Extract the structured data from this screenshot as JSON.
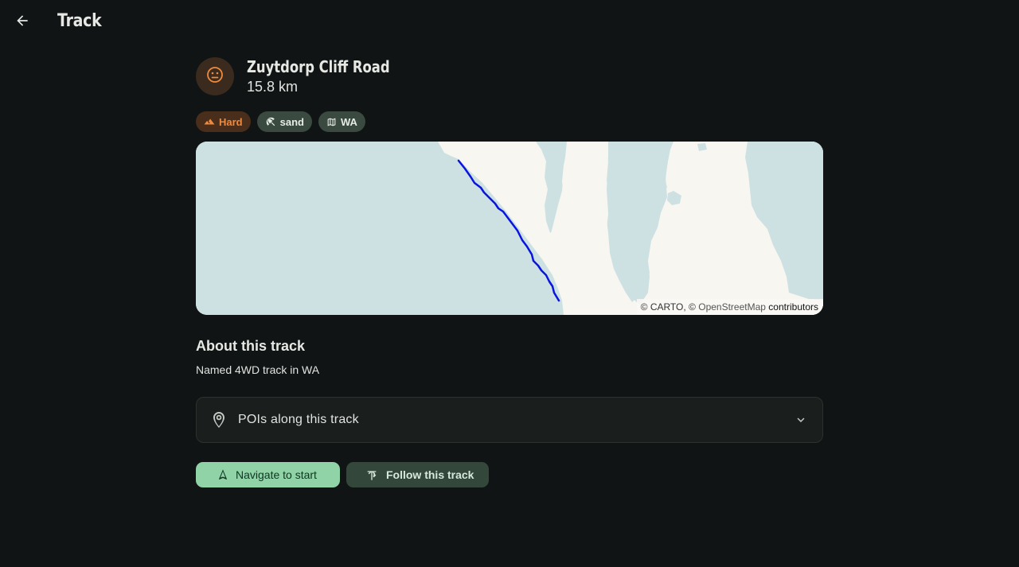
{
  "header": {
    "title": "Track",
    "back_icon": "arrow-back-icon"
  },
  "track": {
    "name": "Zuytdorp Cliff Road",
    "distance": "15.8 km",
    "avatar_icon": "neutral-face-icon",
    "accent_color": "#f08a3c",
    "chips": [
      {
        "label": "Hard",
        "icon": "terrain-icon",
        "color": "#f08a3c"
      },
      {
        "label": "sand",
        "icon": "beach-umbrella-icon"
      },
      {
        "label": "WA",
        "icon": "map-icon"
      }
    ]
  },
  "map": {
    "route_color": "#0a14e0",
    "attribution": {
      "prefix": "© CARTO, © ",
      "osm": "OpenStreetMap",
      "contributors": "contributors"
    }
  },
  "about": {
    "title": "About this track",
    "description": "Named 4WD track in WA"
  },
  "poi": {
    "label": "POIs along this track",
    "icon": "location-pin-icon",
    "expand_icon": "chevron-down-icon"
  },
  "actions": {
    "navigate_label": "Navigate to start",
    "navigate_icon": "navigation-arrow-icon",
    "follow_label": "Follow this track",
    "follow_icon": "fork-route-icon"
  }
}
